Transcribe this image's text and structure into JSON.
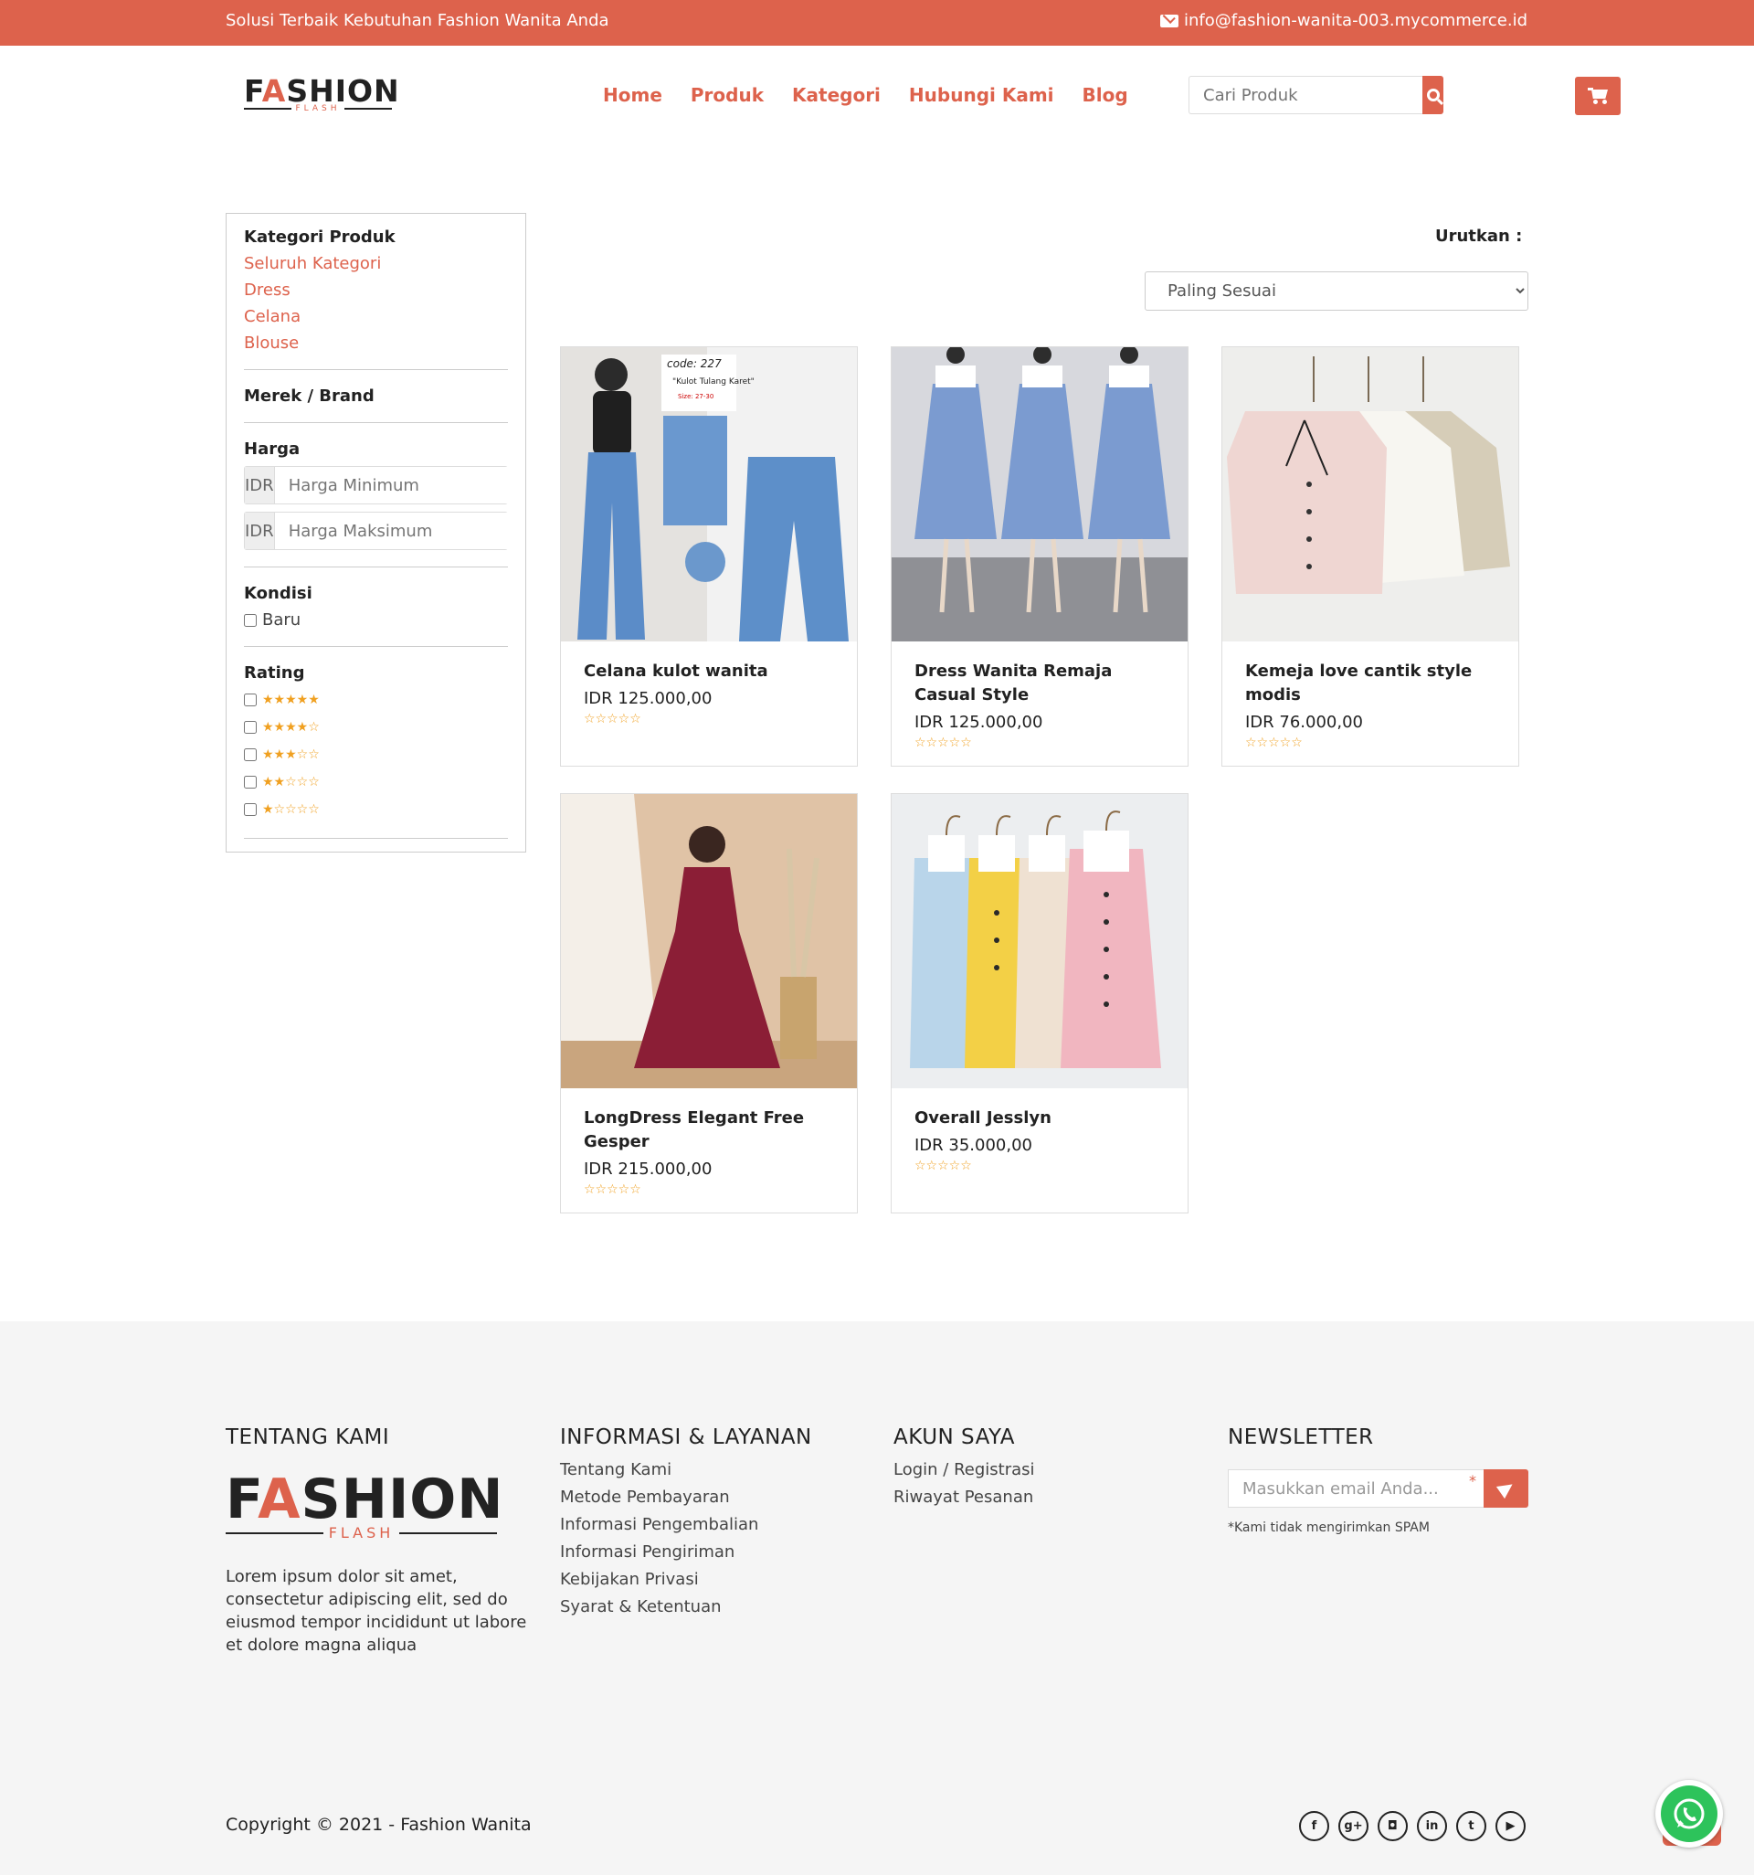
{
  "topbar": {
    "tagline": "Solusi Terbaik Kebutuhan Fashion Wanita Anda",
    "email": "info@fashion-wanita-003.mycommerce.id"
  },
  "logo": {
    "word_a": "F",
    "word_accent": "A",
    "word_b": "SHION",
    "sub": "FLASH"
  },
  "nav": [
    "Home",
    "Produk",
    "Kategori",
    "Hubungi Kami",
    "Blog"
  ],
  "search": {
    "placeholder": "Cari Produk"
  },
  "sidebar": {
    "category_title": "Kategori Produk",
    "categories": [
      "Seluruh Kategori",
      "Dress",
      "Celana",
      "Blouse"
    ],
    "brand_title": "Merek / Brand",
    "price_title": "Harga",
    "currency": "IDR",
    "price_min_placeholder": "Harga Minimum",
    "price_max_placeholder": "Harga Maksimum",
    "condition_title": "Kondisi",
    "condition_option": "Baru",
    "rating_title": "Rating",
    "rating_options": [
      5,
      4,
      3,
      2,
      1
    ]
  },
  "sort": {
    "label": "Urutkan :",
    "selected": "Paling Sesuai"
  },
  "products": [
    {
      "name": "Celana kulot wanita",
      "price": "IDR 125.000,00",
      "rating": 0,
      "image_code": "code: 227",
      "image_caption": "\"Kulot Tulang Karet\"",
      "image_size": "Size: 27-30"
    },
    {
      "name": "Dress Wanita Remaja Casual Style",
      "price": "IDR 125.000,00",
      "rating": 0
    },
    {
      "name": "Kemeja love cantik style modis",
      "price": "IDR 76.000,00",
      "rating": 0
    },
    {
      "name": "LongDress Elegant Free Gesper",
      "price": "IDR 215.000,00",
      "rating": 0
    },
    {
      "name": "Overall Jesslyn",
      "price": "IDR 35.000,00",
      "rating": 0
    }
  ],
  "footer": {
    "about_title": "TENTANG KAMI",
    "about_text": "Lorem ipsum dolor sit amet, consectetur adipiscing elit, sed do eiusmod tempor incididunt ut labore et dolore magna aliqua",
    "info_title": "INFORMASI & LAYANAN",
    "info_links": [
      "Tentang Kami",
      "Metode Pembayaran",
      "Informasi Pengembalian",
      "Informasi Pengiriman",
      "Kebijakan Privasi",
      "Syarat & Ketentuan"
    ],
    "account_title": "AKUN SAYA",
    "account_links": [
      "Login / Registrasi",
      "Riwayat Pesanan"
    ],
    "newsletter_title": "NEWSLETTER",
    "newsletter_placeholder": "Masukkan email Anda...",
    "newsletter_required": "*",
    "newsletter_note": "*Kami tidak mengirimkan SPAM",
    "copyright": "Copyright © 2021 - Fashion Wanita",
    "socials": [
      "facebook",
      "google-plus",
      "instagram",
      "linkedin",
      "twitter",
      "youtube"
    ]
  },
  "colors": {
    "accent": "#dd624c",
    "whatsapp": "#2dc35b"
  }
}
